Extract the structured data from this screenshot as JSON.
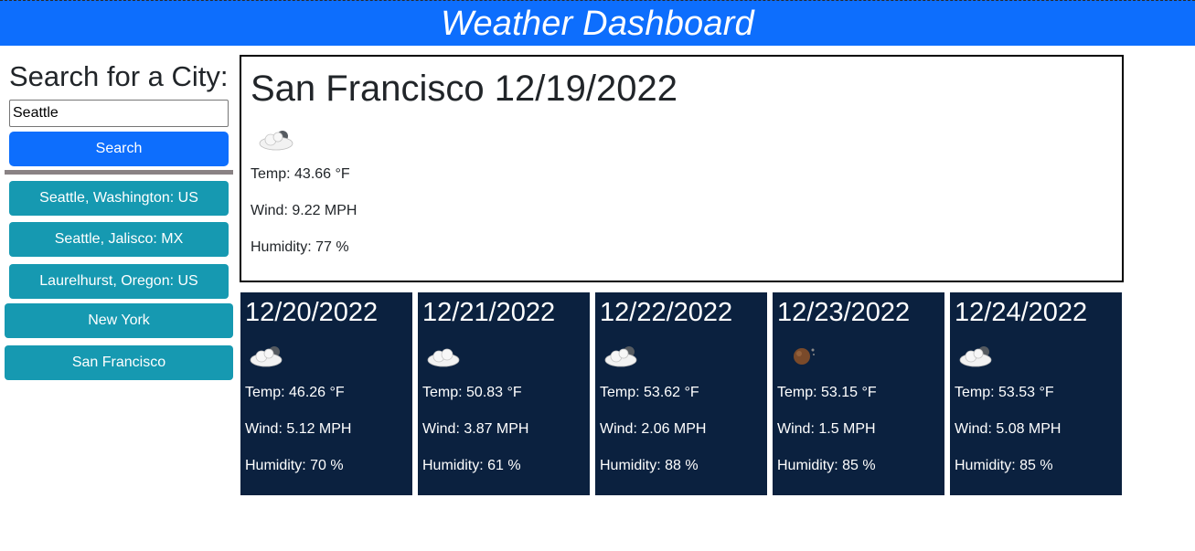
{
  "header": {
    "title": "Weather Dashboard"
  },
  "sidebar": {
    "search_title": "Search for a City:",
    "search_value": "Seattle",
    "search_button": "Search",
    "history": [
      {
        "label": "Seattle, Washington: US"
      },
      {
        "label": "Seattle, Jalisco: MX"
      },
      {
        "label": "Laurelhurst, Oregon: US"
      },
      {
        "label": "New York"
      },
      {
        "label": "San Francisco"
      }
    ]
  },
  "current": {
    "title": "San Francisco 12/19/2022",
    "icon": "partly-cloudy-night-icon",
    "temp": "Temp: 43.66 °F",
    "wind": "Wind: 9.22 MPH",
    "humidity": "Humidity: 77 %"
  },
  "forecast": [
    {
      "date": "12/20/2022",
      "icon": "partly-cloudy-night-icon",
      "temp": "Temp: 46.26 °F",
      "wind": "Wind: 5.12 MPH",
      "humidity": "Humidity: 70 %"
    },
    {
      "date": "12/21/2022",
      "icon": "cloud-icon",
      "temp": "Temp: 50.83 °F",
      "wind": "Wind: 3.87 MPH",
      "humidity": "Humidity: 61 %"
    },
    {
      "date": "12/22/2022",
      "icon": "partly-cloudy-night-icon",
      "temp": "Temp: 53.62 °F",
      "wind": "Wind: 2.06 MPH",
      "humidity": "Humidity: 88 %"
    },
    {
      "date": "12/23/2022",
      "icon": "clear-night-icon",
      "temp": "Temp: 53.15 °F",
      "wind": "Wind: 1.5 MPH",
      "humidity": "Humidity: 85 %"
    },
    {
      "date": "12/24/2022",
      "icon": "partly-cloudy-night-icon",
      "temp": "Temp: 53.53 °F",
      "wind": "Wind: 5.08 MPH",
      "humidity": "Humidity: 85 %"
    }
  ],
  "colors": {
    "header_bg": "#0d6efd",
    "search_button_bg": "#0d6efd",
    "history_button_bg": "#1699b1",
    "forecast_bg": "#0b213f"
  }
}
